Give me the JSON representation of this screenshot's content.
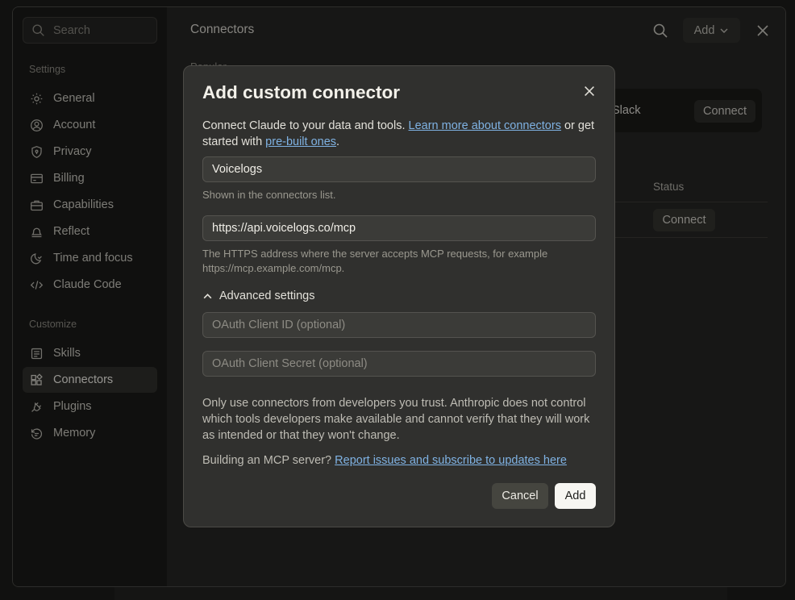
{
  "sidebar": {
    "search_placeholder": "Search",
    "settings_label": "Settings",
    "settings_items": [
      {
        "label": "General",
        "icon": "gear-icon"
      },
      {
        "label": "Account",
        "icon": "user-circle-icon"
      },
      {
        "label": "Privacy",
        "icon": "shield-icon"
      },
      {
        "label": "Billing",
        "icon": "credit-card-icon"
      },
      {
        "label": "Capabilities",
        "icon": "briefcase-icon"
      },
      {
        "label": "Reflect",
        "icon": "bell-icon"
      },
      {
        "label": "Time and focus",
        "icon": "moon-icon"
      },
      {
        "label": "Claude Code",
        "icon": "code-icon"
      }
    ],
    "customize_label": "Customize",
    "customize_items": [
      {
        "label": "Skills",
        "icon": "skills-icon"
      },
      {
        "label": "Connectors",
        "icon": "connectors-icon",
        "active": true
      },
      {
        "label": "Plugins",
        "icon": "plug-icon"
      },
      {
        "label": "Memory",
        "icon": "memory-icon"
      }
    ]
  },
  "main": {
    "title": "Connectors",
    "add_label": "Add",
    "popular_label": "Popular",
    "card": {
      "name": "Slack",
      "button": "Connect"
    },
    "table": {
      "status_header": "Status",
      "row_button": "Connect"
    }
  },
  "modal": {
    "title": "Add custom connector",
    "intro_prefix": "Connect Claude to your data and tools. ",
    "intro_link1": "Learn more about connectors",
    "intro_mid": " or get started with ",
    "intro_link2": "pre-built ones",
    "intro_suffix": ".",
    "name_value": "Voicelogs",
    "name_hint": "Shown in the connectors list.",
    "url_value": "https://api.voicelogs.co/mcp",
    "url_hint": "The HTTPS address where the server accepts MCP requests, for example https://mcp.example.com/mcp.",
    "advanced_label": "Advanced settings",
    "client_id_placeholder": "OAuth Client ID (optional)",
    "client_secret_placeholder": "OAuth Client Secret (optional)",
    "warning": "Only use connectors from developers you trust. Anthropic does not control which tools developers make available and cannot verify that they will work as intended or that they won't change.",
    "build_prefix": "Building an MCP server? ",
    "build_link": "Report issues and subscribe to updates here",
    "cancel_label": "Cancel",
    "add_label": "Add"
  }
}
